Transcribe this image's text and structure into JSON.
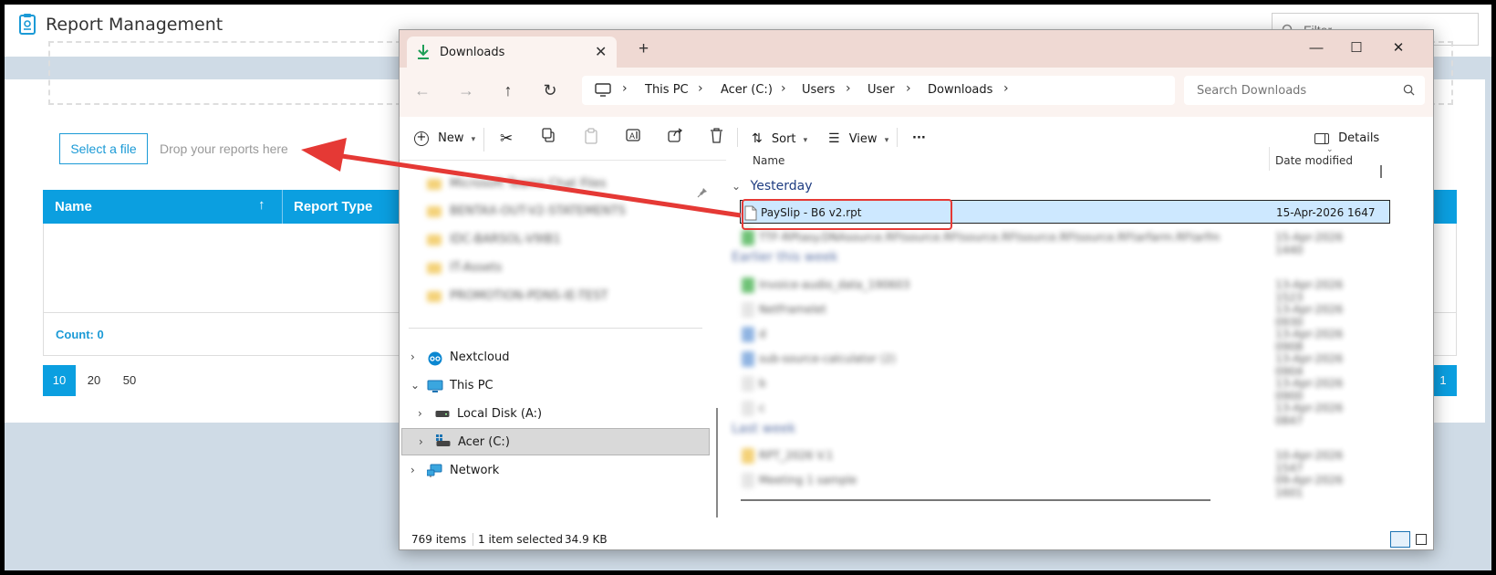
{
  "app": {
    "title": "Report Management",
    "filter_placeholder": "Filter",
    "select_file_label": "Select a file",
    "drop_hint": "Drop your reports here",
    "grid": {
      "columns": [
        "Name",
        "Report Type"
      ],
      "sort_indicator": "↑",
      "count_label": "Count: 0"
    },
    "pager": {
      "page_sizes": [
        "10",
        "20",
        "50"
      ],
      "active_page_size": "10",
      "current_page": "1"
    }
  },
  "explorer": {
    "tab_title": "Downloads",
    "tab_close": "✕",
    "new_tab": "+",
    "window_controls": {
      "minimize": "—",
      "maximize": "☐",
      "close": "✕"
    },
    "nav": {
      "back": "←",
      "forward": "→",
      "up": "↑",
      "refresh": "↻"
    },
    "breadcrumb": [
      "This PC",
      "Acer (C:)",
      "Users",
      "User",
      "Downloads"
    ],
    "search_placeholder": "Search Downloads",
    "toolbar": {
      "new_label": "New",
      "sort_label": "Sort",
      "view_label": "View",
      "more_label": "···",
      "details_label": "Details"
    },
    "nav_pane": {
      "pinned_blurred": [
        "Microsoft Teams Chat Files",
        "BENTAX-OUT-V2-STATEMENTS",
        "IDC-BARSOL-V9IB1",
        "IT-Assets",
        "PROMOTION-PDNS-IE-TEST"
      ],
      "items": [
        {
          "label": "Nextcloud",
          "icon": "nextcloud-icon"
        },
        {
          "label": "This PC",
          "icon": "monitor-icon"
        },
        {
          "label": "Local Disk (A:)",
          "icon": "drive-icon"
        },
        {
          "label": "Acer (C:)",
          "icon": "drive-icon"
        },
        {
          "label": "Network",
          "icon": "network-icon"
        }
      ]
    },
    "columns": {
      "name": "Name",
      "date_modified": "Date modified"
    },
    "groups": {
      "yesterday": "Yesterday",
      "earlier_this_week": "Earlier this week",
      "last_week": "Last week"
    },
    "selected_file": {
      "name": "PaySlip - B6 v2.rpt",
      "date": "15-Apr-2026 1647"
    },
    "blurred_files": [
      {
        "name": "TTF-RPtasy.DNAsource.RFtsource.RFtsource.RFtsource.RFtsource.RFtarfarm.RFtarfm",
        "date": "15-Apr-2026 1440"
      },
      {
        "name": "Invoice-audio_data_190603",
        "date": "13-Apr-2026 1523"
      },
      {
        "name": "NetFramelet",
        "date": "13-Apr-2026 0930"
      },
      {
        "name": "d",
        "date": "13-Apr-2026 0908"
      },
      {
        "name": "sub-source-calculator (2)",
        "date": "13-Apr-2026 0904"
      },
      {
        "name": "b",
        "date": "13-Apr-2026 0900"
      },
      {
        "name": "c",
        "date": "13-Apr-2026 0847"
      },
      {
        "name": "RPT_2026 V.1",
        "date": "10-Apr-2026 1547"
      },
      {
        "name": "Meeting 1 sample",
        "date": "09-Apr-2026 1601"
      }
    ],
    "status": {
      "items": "769 items",
      "selection": "1 item selected",
      "size": "34.9 KB"
    }
  }
}
